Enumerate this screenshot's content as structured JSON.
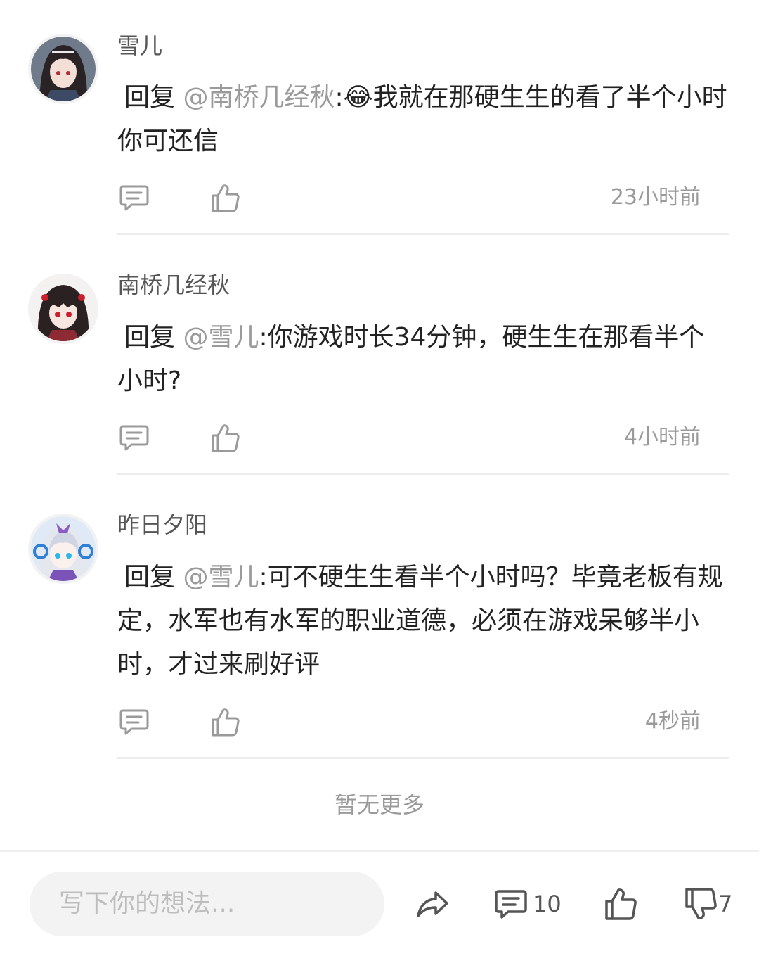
{
  "comments": [
    {
      "user": "雪儿",
      "reply_prefix": "回复 ",
      "mention": "@南桥几经秋",
      "text": ":😂我就在那硬生生的看了半个小时你可还信",
      "time": "23小时前"
    },
    {
      "user": "南桥几经秋",
      "reply_prefix": "回复 ",
      "mention": "@雪儿",
      "text": ":你游戏时长34分钟，硬生生在那看半个小时?",
      "time": "4小时前"
    },
    {
      "user": "昨日夕阳",
      "reply_prefix": "回复 ",
      "mention": "@雪儿",
      "text": ":可不硬生生看半个小时吗？毕竟老板有规定，水军也有水军的职业道德，必须在游戏呆够半小时，才过来刷好评",
      "time": "4秒前"
    }
  ],
  "footer": {
    "no_more": "暂无更多"
  },
  "bottom_bar": {
    "compose_placeholder": "写下你的想法...",
    "comment_count": "10",
    "dislike_count": "7"
  },
  "icons": {
    "reply": "comment-bubble-icon",
    "like": "thumbs-up-icon",
    "share": "share-arrow-icon",
    "dislike": "thumbs-down-icon"
  },
  "colors": {
    "text": "#222222",
    "muted": "#9a9a9a",
    "divider": "#ececec",
    "compose_bg": "#f3f3f3"
  }
}
